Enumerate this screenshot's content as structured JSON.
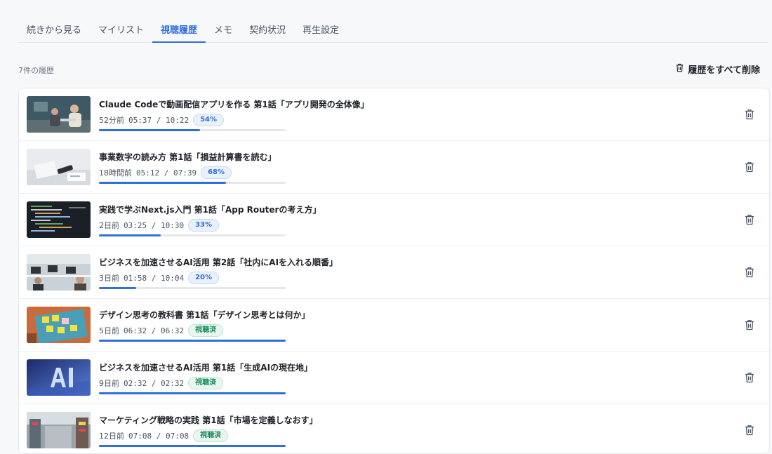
{
  "tabs": [
    {
      "label": "続きから見る",
      "active": false
    },
    {
      "label": "マイリスト",
      "active": false
    },
    {
      "label": "視聴履歴",
      "active": true
    },
    {
      "label": "メモ",
      "active": false
    },
    {
      "label": "契約状況",
      "active": false
    },
    {
      "label": "再生設定",
      "active": false
    }
  ],
  "history": {
    "count_label": "7件の履歴",
    "delete_all_label": "履歴をすべて削除",
    "items": [
      {
        "title": "Claude Codeで動画配信アプリを作る 第1話「アプリ開発の全体像」",
        "ago": "52分前",
        "time": "05:37 / 10:22",
        "badge": "54%",
        "badge_type": "pct",
        "progress": 0.54,
        "thumb": "meeting"
      },
      {
        "title": "事業数字の読み方 第1話「損益計算書を読む」",
        "ago": "18時間前",
        "time": "05:12 / 07:39",
        "badge": "68%",
        "badge_type": "pct",
        "progress": 0.68,
        "thumb": "desk"
      },
      {
        "title": "実践で学ぶNext.js入門 第1話「App Routerの考え方」",
        "ago": "2日前",
        "time": "03:25 / 10:30",
        "badge": "33%",
        "badge_type": "pct",
        "progress": 0.33,
        "thumb": "code"
      },
      {
        "title": "ビジネスを加速させるAI活用 第2話「社内にAIを入れる順番」",
        "ago": "3日前",
        "time": "01:58 / 10:04",
        "badge": "20%",
        "badge_type": "pct",
        "progress": 0.2,
        "thumb": "office"
      },
      {
        "title": "デザイン思考の教科書 第1話「デザイン思考とは何か」",
        "ago": "5日前",
        "time": "06:32 / 06:32",
        "badge": "視聴済",
        "badge_type": "done",
        "progress": 1.0,
        "thumb": "sticky"
      },
      {
        "title": "ビジネスを加速させるAI活用 第1話「生成AIの現在地」",
        "ago": "9日前",
        "time": "02:32 / 02:32",
        "badge": "視聴済",
        "badge_type": "done",
        "progress": 1.0,
        "thumb": "ai"
      },
      {
        "title": "マーケティング戦略の実践 第1話「市場を定義しなおす」",
        "ago": "12日前",
        "time": "07:08 / 07:08",
        "badge": "視聴済",
        "badge_type": "done",
        "progress": 1.0,
        "thumb": "street"
      }
    ]
  },
  "icons": {
    "trash": "trash-icon"
  },
  "colors": {
    "accent": "#2f6fe0",
    "done": "#1c8a5a"
  }
}
